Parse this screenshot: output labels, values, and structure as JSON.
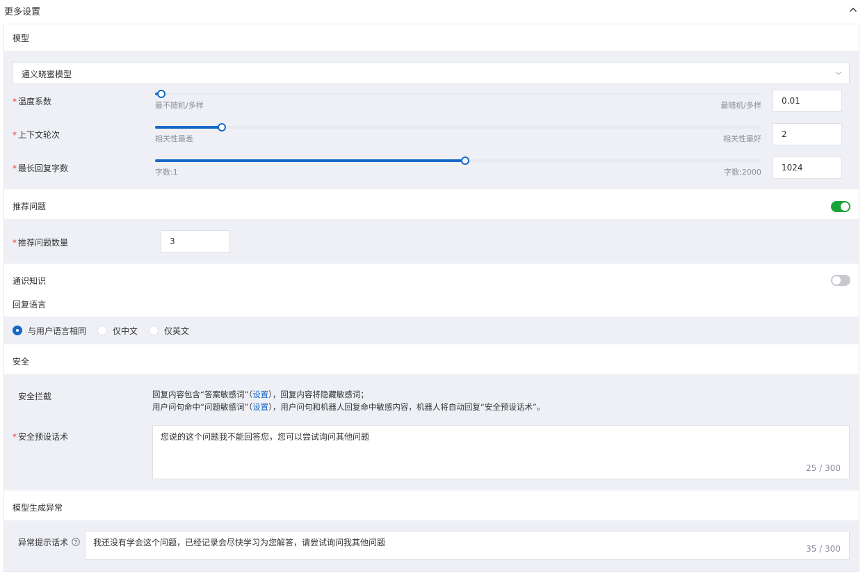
{
  "header": {
    "title": "更多设置",
    "collapse_icon": "chevron-up-icon"
  },
  "model": {
    "section_title": "模型",
    "select_value": "通义晓蜜模型",
    "params": [
      {
        "label": "温度系数",
        "left_hint": "最不随机/多样",
        "right_hint": "最随机/多样",
        "value": "0.01",
        "level": 0.01
      },
      {
        "label": "上下文轮次",
        "left_hint": "相关性最差",
        "right_hint": "相关性最好",
        "value": "2",
        "level": 0.11
      },
      {
        "label": "最长回复字数",
        "left_hint": "字数:1",
        "right_hint": "字数:2000",
        "value": "1024",
        "level": 0.512
      }
    ]
  },
  "recommend": {
    "section_title": "推荐问题",
    "enabled": true,
    "count_label": "推荐问题数量",
    "count_value": "3"
  },
  "common_knowledge": {
    "section_title": "通识知识",
    "enabled": false
  },
  "reply_language": {
    "section_title": "回复语言",
    "options": [
      "与用户语言相同",
      "仅中文",
      "仅英文"
    ],
    "selected": "与用户语言相同"
  },
  "security": {
    "section_title": "安全",
    "block_label": "安全拦截",
    "line1_a": "回复内容包含“答案敏感词”（",
    "line1_link": "设置",
    "line1_b": "），回复内容将隐藏敏感词；",
    "line2_a": "用户问句命中“问题敏感词”（",
    "line2_link": "设置",
    "line2_b": "），用户问句和机器人回复命中敏感内容，机器人将自动回复“安全预设话术”。",
    "preset_label": "安全预设话术",
    "preset_text": "您说的这个问题我不能回答您，您可以尝试询问其他问题",
    "preset_count": "25 / 300"
  },
  "exception": {
    "section_title": "模型生成异常",
    "hint_label": "异常提示话术",
    "hint_text": "我还没有学会这个问题，已经记录会尽快学习为您解答，请尝试询问我其他问题",
    "hint_count": "35 / 300"
  },
  "colors": {
    "accent": "#1769c7",
    "toggle_on": "#1aa33a",
    "toggle_off": "#c7c9cf",
    "required": "#e23c39",
    "section_bg": "#eef0f5"
  }
}
